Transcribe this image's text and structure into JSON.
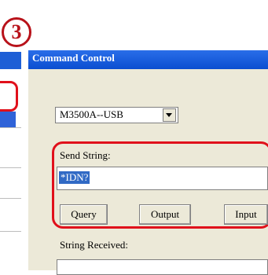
{
  "step_marker": "3",
  "window": {
    "title": "Command Control"
  },
  "device_select": {
    "value": "M3500A--USB"
  },
  "send": {
    "label": "Send String:",
    "value": "*IDN?"
  },
  "buttons": {
    "query": "Query",
    "output": "Output",
    "input": "Input"
  },
  "received": {
    "label": "String Received:",
    "value": ""
  },
  "colors": {
    "title_bar": "#0b4ed0",
    "highlight": "#316ac5",
    "callout": "#e0101b"
  }
}
